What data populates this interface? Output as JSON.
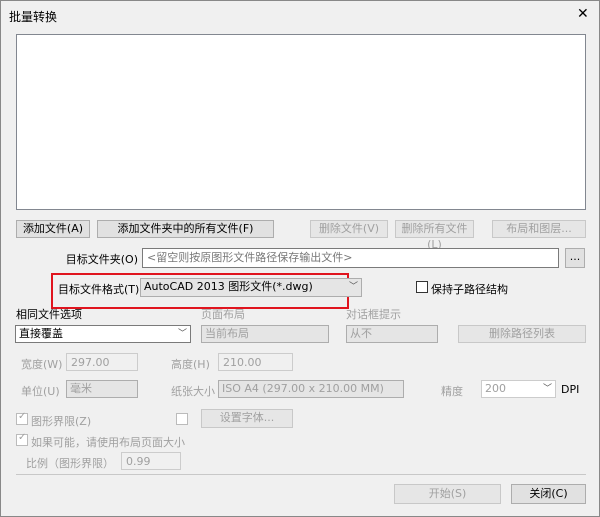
{
  "window": {
    "title": "批量转换",
    "close": "✕"
  },
  "buttons": {
    "add_file": "添加文件(A)",
    "add_folder": "添加文件夹中的所有文件(F)",
    "remove_file": "删除文件(V)",
    "remove_all": "删除所有文件(L)",
    "layout_layers": "布局和图层...",
    "browse": "...",
    "set_font": "设置字体...",
    "start": "开始(S)",
    "close": "关闭(C)",
    "clear_path": "删除路径列表"
  },
  "target_folder": {
    "label": "目标文件夹(O)",
    "placeholder": "<留空则按原图形文件路径保存输出文件>"
  },
  "target_format": {
    "label": "目标文件格式(T)",
    "value": "AutoCAD 2013 图形文件(*.dwg)",
    "highlight_color": "#e0141e"
  },
  "keep_subpath": {
    "label": "保持子路径结构",
    "checked": false
  },
  "same_file": {
    "label": "相同文件选项",
    "value": "直接覆盖"
  },
  "page_layout": {
    "label": "页面布局",
    "value": "当前布局"
  },
  "prompt": {
    "label": "对话框提示",
    "value": "从不"
  },
  "width": {
    "label": "宽度(W)",
    "value": "297.00"
  },
  "height": {
    "label": "高度(H)",
    "value": "210.00"
  },
  "unit": {
    "label": "单位(U)",
    "value": "毫米"
  },
  "paper": {
    "label": "纸张大小",
    "value": "ISO A4 (297.00 x 210.00 MM)"
  },
  "resolution": {
    "label": "精度",
    "value": "200",
    "unit": "DPI"
  },
  "extents": {
    "label": "图形界限(Z)",
    "checked": true
  },
  "use_layout": {
    "label": "如果可能，请使用布局页面大小",
    "checked": true
  },
  "scale": {
    "label": "比例（图形界限）",
    "value": "0.99"
  }
}
